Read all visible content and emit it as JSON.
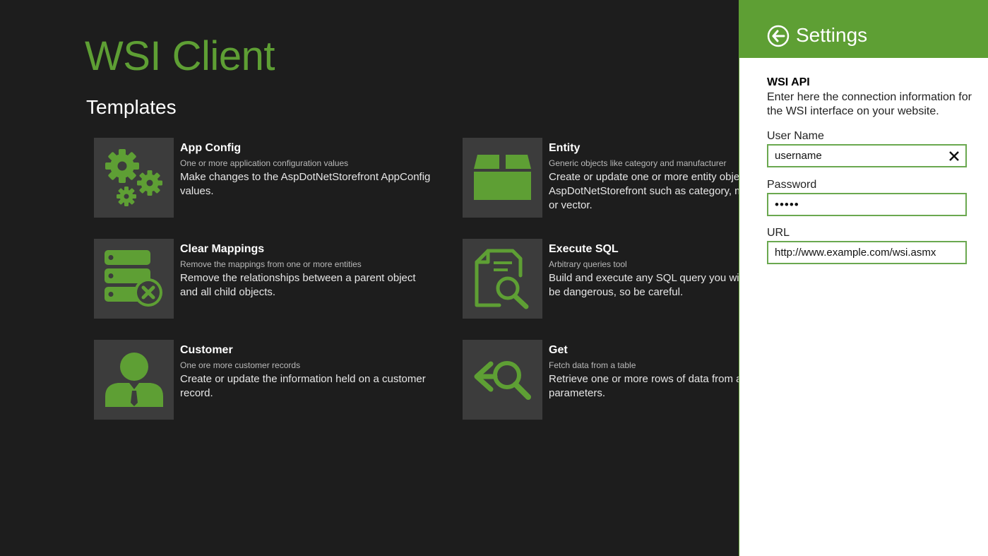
{
  "app": {
    "title": "WSI Client",
    "section_title": "Templates"
  },
  "accent_color": "#5e9f34",
  "tiles": [
    {
      "icon": "gears-icon",
      "name": "App Config",
      "subtitle": "One or more application configuration values",
      "description": "Make changes to the AspDotNetStorefront AppConfig values."
    },
    {
      "icon": "box-icon",
      "name": "Entity",
      "subtitle": "Generic objects like category and manufacturer",
      "description": "Create or update one or more entity objects in AspDotNetStorefront such as category, manufacturer or vector."
    },
    {
      "icon": "database-remove-icon",
      "name": "Clear Mappings",
      "subtitle": "Remove the mappings from one or more entities",
      "description": "Remove the relationships between a parent object and all child objects."
    },
    {
      "icon": "document-search-icon",
      "name": "Execute SQL",
      "subtitle": "Arbitrary queries tool",
      "description": "Build and execute any SQL query you wish. This can be dangerous, so be careful."
    },
    {
      "icon": "user-icon",
      "name": "Customer",
      "subtitle": "One ore more customer records",
      "description": "Create or update the information held on a customer record."
    },
    {
      "icon": "fetch-search-icon",
      "name": "Get",
      "subtitle": "Fetch data from a table",
      "description": "Retrieve one or more rows of data from a table using parameters."
    }
  ],
  "settings": {
    "title": "Settings",
    "back_icon": "back-arrow-icon",
    "group_title": "WSI API",
    "group_description": "Enter here the connection information for the WSI interface on your website.",
    "username_label": "User Name",
    "username_value": "username",
    "password_label": "Password",
    "password_value": "•••••",
    "url_label": "URL",
    "url_value": "http://www.example.com/wsi.asmx",
    "clear_icon": "close-icon"
  }
}
